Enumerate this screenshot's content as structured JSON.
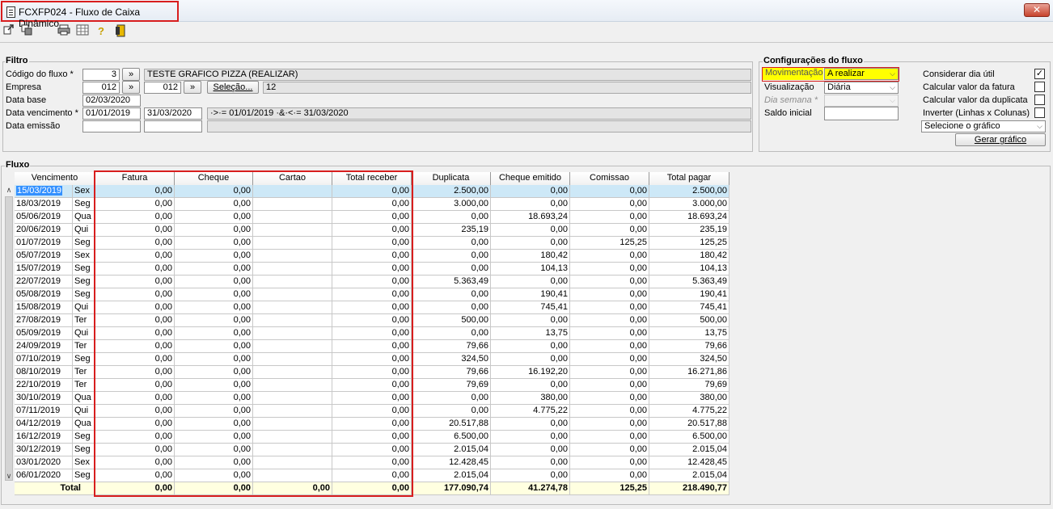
{
  "window": {
    "title": "FCXFP024 - Fluxo de Caixa Dinâmico",
    "close_glyph": "✕"
  },
  "toolbar": {
    "icons": [
      "export-icon",
      "copy-icon",
      "print-icon",
      "calc-icon",
      "help-icon",
      "exit-icon"
    ]
  },
  "filtro": {
    "label": "Filtro",
    "codigo_label": "Código do fluxo *",
    "codigo_value": "3",
    "codigo_desc": "TESTE GRAFICO PIZZA (REALIZAR)",
    "empresa_label": "Empresa",
    "empresa_value": "012",
    "empresa_value2": "012",
    "selecao_label": "Seleção...",
    "selecao_value": "12",
    "data_base_label": "Data base",
    "data_base_value": "02/03/2020",
    "data_venc_label": "Data vencimento *",
    "data_venc_from": "01/01/2019",
    "data_venc_to": "31/03/2020",
    "data_venc_expr": "·>·= 01/01/2019 ·&·<·= 31/03/2020",
    "data_emissao_label": "Data emissão",
    "lookup_glyph": "»"
  },
  "config": {
    "label": "Configurações do fluxo",
    "movimentacao_label": "Movimentação",
    "movimentacao_value": "A realizar",
    "visualizacao_label": "Visualização",
    "visualizacao_value": "Diária",
    "dia_semana_label": "Dia semana *",
    "saldo_label": "Saldo inicial",
    "considerar_label": "Considerar dia útil",
    "calc_fatura_label": "Calcular valor da fatura",
    "calc_duplicata_label": "Calcular valor da duplicata",
    "inverter_label": "Inverter (Linhas x Colunas)",
    "grafico_value": "Selecione o gráfico",
    "gerar_label": "Gerar gráfico",
    "check_glyph": "✓",
    "chevron_glyph": "⌵"
  },
  "fluxo": {
    "label": "Fluxo",
    "headers": [
      "Vencimento",
      "Fatura",
      "Cheque",
      "Cartao",
      "Total receber",
      "Duplicata",
      "Cheque emitido",
      "Comissao",
      "Total pagar"
    ],
    "rows": [
      [
        "15/03/2019",
        "Sex",
        "0,00",
        "0,00",
        "",
        "0,00",
        "2.500,00",
        "0,00",
        "0,00",
        "2.500,00"
      ],
      [
        "18/03/2019",
        "Seg",
        "0,00",
        "0,00",
        "",
        "0,00",
        "3.000,00",
        "0,00",
        "0,00",
        "3.000,00"
      ],
      [
        "05/06/2019",
        "Qua",
        "0,00",
        "0,00",
        "",
        "0,00",
        "0,00",
        "18.693,24",
        "0,00",
        "18.693,24"
      ],
      [
        "20/06/2019",
        "Qui",
        "0,00",
        "0,00",
        "",
        "0,00",
        "235,19",
        "0,00",
        "0,00",
        "235,19"
      ],
      [
        "01/07/2019",
        "Seg",
        "0,00",
        "0,00",
        "",
        "0,00",
        "0,00",
        "0,00",
        "125,25",
        "125,25"
      ],
      [
        "05/07/2019",
        "Sex",
        "0,00",
        "0,00",
        "",
        "0,00",
        "0,00",
        "180,42",
        "0,00",
        "180,42"
      ],
      [
        "15/07/2019",
        "Seg",
        "0,00",
        "0,00",
        "",
        "0,00",
        "0,00",
        "104,13",
        "0,00",
        "104,13"
      ],
      [
        "22/07/2019",
        "Seg",
        "0,00",
        "0,00",
        "",
        "0,00",
        "5.363,49",
        "0,00",
        "0,00",
        "5.363,49"
      ],
      [
        "05/08/2019",
        "Seg",
        "0,00",
        "0,00",
        "",
        "0,00",
        "0,00",
        "190,41",
        "0,00",
        "190,41"
      ],
      [
        "15/08/2019",
        "Qui",
        "0,00",
        "0,00",
        "",
        "0,00",
        "0,00",
        "745,41",
        "0,00",
        "745,41"
      ],
      [
        "27/08/2019",
        "Ter",
        "0,00",
        "0,00",
        "",
        "0,00",
        "500,00",
        "0,00",
        "0,00",
        "500,00"
      ],
      [
        "05/09/2019",
        "Qui",
        "0,00",
        "0,00",
        "",
        "0,00",
        "0,00",
        "13,75",
        "0,00",
        "13,75"
      ],
      [
        "24/09/2019",
        "Ter",
        "0,00",
        "0,00",
        "",
        "0,00",
        "79,66",
        "0,00",
        "0,00",
        "79,66"
      ],
      [
        "07/10/2019",
        "Seg",
        "0,00",
        "0,00",
        "",
        "0,00",
        "324,50",
        "0,00",
        "0,00",
        "324,50"
      ],
      [
        "08/10/2019",
        "Ter",
        "0,00",
        "0,00",
        "",
        "0,00",
        "79,66",
        "16.192,20",
        "0,00",
        "16.271,86"
      ],
      [
        "22/10/2019",
        "Ter",
        "0,00",
        "0,00",
        "",
        "0,00",
        "79,69",
        "0,00",
        "0,00",
        "79,69"
      ],
      [
        "30/10/2019",
        "Qua",
        "0,00",
        "0,00",
        "",
        "0,00",
        "0,00",
        "380,00",
        "0,00",
        "380,00"
      ],
      [
        "07/11/2019",
        "Qui",
        "0,00",
        "0,00",
        "",
        "0,00",
        "0,00",
        "4.775,22",
        "0,00",
        "4.775,22"
      ],
      [
        "04/12/2019",
        "Qua",
        "0,00",
        "0,00",
        "",
        "0,00",
        "20.517,88",
        "0,00",
        "0,00",
        "20.517,88"
      ],
      [
        "16/12/2019",
        "Seg",
        "0,00",
        "0,00",
        "",
        "0,00",
        "6.500,00",
        "0,00",
        "0,00",
        "6.500,00"
      ],
      [
        "30/12/2019",
        "Seg",
        "0,00",
        "0,00",
        "",
        "0,00",
        "2.015,04",
        "0,00",
        "0,00",
        "2.015,04"
      ],
      [
        "03/01/2020",
        "Sex",
        "0,00",
        "0,00",
        "",
        "0,00",
        "12.428,45",
        "0,00",
        "0,00",
        "12.428,45"
      ],
      [
        "06/01/2020",
        "Seg",
        "0,00",
        "0,00",
        "",
        "0,00",
        "2.015,04",
        "0,00",
        "0,00",
        "2.015,04"
      ]
    ],
    "total": [
      "Total",
      "",
      "0,00",
      "0,00",
      "0,00",
      "0,00",
      "177.090,74",
      "41.274,78",
      "125,25",
      "218.490,77"
    ],
    "scroll_up": "∧",
    "scroll_down": "∨"
  }
}
